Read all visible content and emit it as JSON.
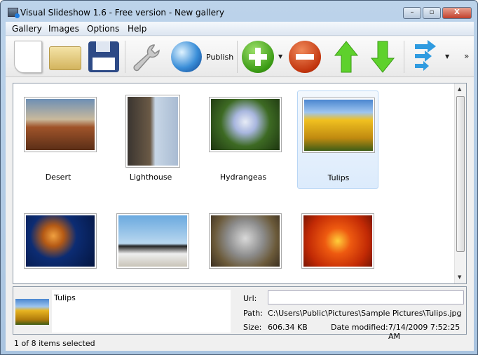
{
  "window": {
    "title": "Visual Slideshow 1.6 - Free version - New gallery",
    "minimize": "–",
    "maximize": "▫",
    "close": "X"
  },
  "menu": [
    "Gallery",
    "Images",
    "Options",
    "Help"
  ],
  "toolbar": {
    "publish_label": "Publish",
    "overflow": "»",
    "dropdown": "▼",
    "icons": [
      "new-gallery-icon",
      "open-folder-icon",
      "save-disk-icon",
      "settings-wrench-icon",
      "publish-globe-icon",
      "add-images-icon",
      "remove-image-icon",
      "move-up-icon",
      "move-down-icon",
      "export-arrows-icon"
    ]
  },
  "gallery": {
    "items": [
      {
        "label": "Desert",
        "selected": false
      },
      {
        "label": "Lighthouse",
        "selected": false
      },
      {
        "label": "Hydrangeas",
        "selected": false
      },
      {
        "label": "Tulips",
        "selected": true
      },
      {
        "label": "",
        "selected": false
      },
      {
        "label": "",
        "selected": false
      },
      {
        "label": "",
        "selected": false
      },
      {
        "label": "",
        "selected": false
      }
    ]
  },
  "details": {
    "name": "Tulips",
    "url_label": "Url:",
    "url_value": "",
    "path_label": "Path:",
    "path": "C:\\Users\\Public\\Pictures\\Sample Pictures\\Tulips.jpg",
    "size_label": "Size:",
    "size": "606.34 KB",
    "date_label": "Date modified:",
    "date": "7/14/2009 7:52:25 AM"
  },
  "status": "1 of 8 items selected"
}
